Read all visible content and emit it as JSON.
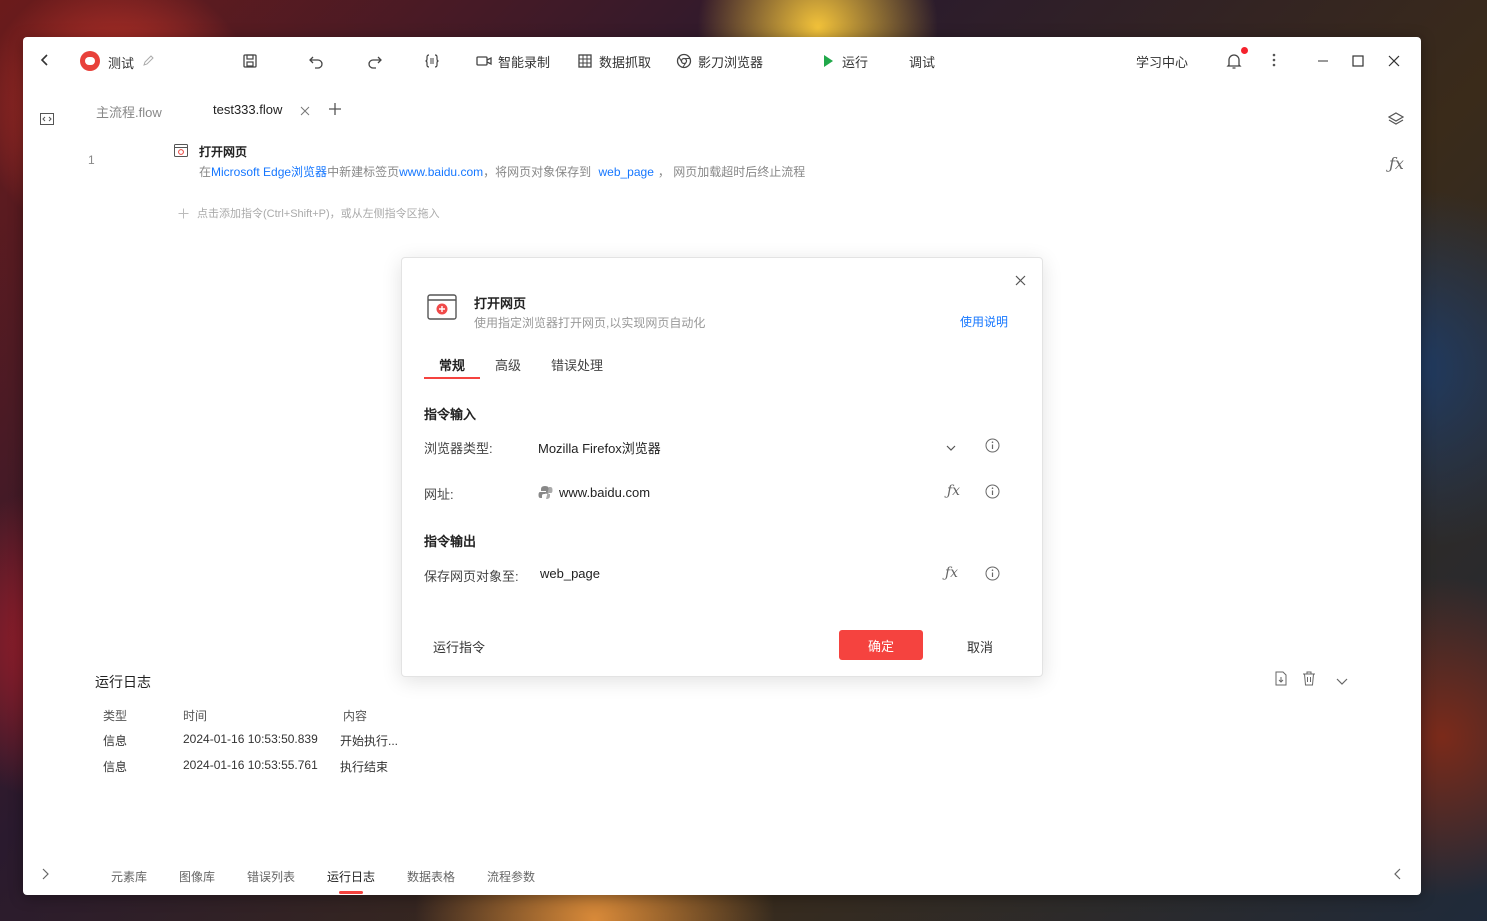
{
  "titlebar": {
    "app_name": "测试",
    "record_label": "智能录制",
    "scrape_label": "数据抓取",
    "browser_label": "影刀浏览器",
    "run_label": "运行",
    "debug_label": "调试",
    "learn_label": "学习中心"
  },
  "tabs": [
    {
      "label": "主流程.flow"
    },
    {
      "label": "test333.flow"
    }
  ],
  "flow": {
    "line_number": "1",
    "step_title": "打开网页",
    "desc_prefix": "在",
    "desc_browser": "Microsoft Edge浏览器",
    "desc_mid": "中新建标签页",
    "desc_url": "www.baidu.com",
    "desc_save": "，将网页对象保存到",
    "desc_var": "web_page",
    "desc_suffix": "，  网页加载超时后终止流程",
    "add_hint": "点击添加指令(Ctrl+Shift+P)，或从左侧指令区拖入"
  },
  "dialog": {
    "title": "打开网页",
    "subtitle": "使用指定浏览器打开网页,以实现网页自动化",
    "help_link": "使用说明",
    "tabs": [
      "常规",
      "高级",
      "错误处理"
    ],
    "input_section": "指令输入",
    "browser_type_label": "浏览器类型:",
    "browser_type_value": "Mozilla Firefox浏览器",
    "url_label": "网址:",
    "url_value": "www.baidu.com",
    "output_section": "指令输出",
    "save_label": "保存网页对象至:",
    "save_value": "web_page",
    "run_cmd": "运行指令",
    "confirm": "确定",
    "cancel": "取消"
  },
  "log": {
    "title": "运行日志",
    "headers": [
      "类型",
      "时间",
      "内容"
    ],
    "rows": [
      {
        "type": "信息",
        "time": "2024-01-16 10:53:50.839",
        "content": "开始执行..."
      },
      {
        "type": "信息",
        "time": "2024-01-16 10:53:55.761",
        "content": "执行结束"
      }
    ]
  },
  "bottom_tabs": [
    "元素库",
    "图像库",
    "错误列表",
    "运行日志",
    "数据表格",
    "流程参数"
  ],
  "colors": {
    "accent_red": "#f5433f",
    "link_blue": "#1677ff",
    "run_green": "#21a84a"
  }
}
